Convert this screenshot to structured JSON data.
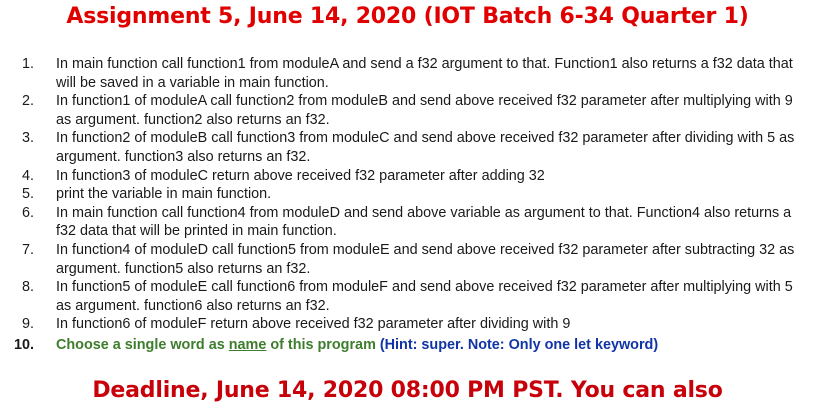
{
  "title": "Assignment 5, June 14, 2020 (IOT Batch 6-34 Quarter 1)",
  "items": [
    {
      "num": "1.",
      "text": "In main function call function1 from moduleA and send a f32 argument to that. Function1 also returns a f32 data that will be saved in a variable in main function."
    },
    {
      "num": "2.",
      "text": "In function1 of moduleA call function2 from moduleB and send above received f32 parameter after multiplying with 9  as argument. function2 also returns an f32."
    },
    {
      "num": "3.",
      "text": "In function2 of moduleB call function3 from moduleC and send above received f32 parameter after dividing with 5  as argument. function3 also returns an f32."
    },
    {
      "num": "4.",
      "text": "In function3 of moduleC return above received f32 parameter after adding 32"
    },
    {
      "num": "5.",
      "text": "print  the variable in main function."
    },
    {
      "num": "6.",
      "text": "In main function call function4 from moduleD and send above variable as argument to that. Function4 also returns a f32 data that will be printed in main function."
    },
    {
      "num": "7.",
      "text": "In function4 of moduleD call function5 from moduleE and send above received f32 parameter after subtracting 32 as argument. function5 also returns an f32."
    },
    {
      "num": "8.",
      "text": "In function5 of moduleE call function6 from moduleF and send above received f32 parameter after multiplying with 5  as argument. function6 also returns an f32."
    },
    {
      "num": "9.",
      "text": "In function6 of moduleF return above received f32 parameter after dividing with 9"
    }
  ],
  "last_item": {
    "num": "10.",
    "part1": "Choose a single word as ",
    "underlined": "name",
    "part2": " of this program",
    "hint": " (Hint: super. Note: Only one let keyword)"
  },
  "deadline": "Deadline, June 14, 2020 08:00 PM PST. You can also"
}
